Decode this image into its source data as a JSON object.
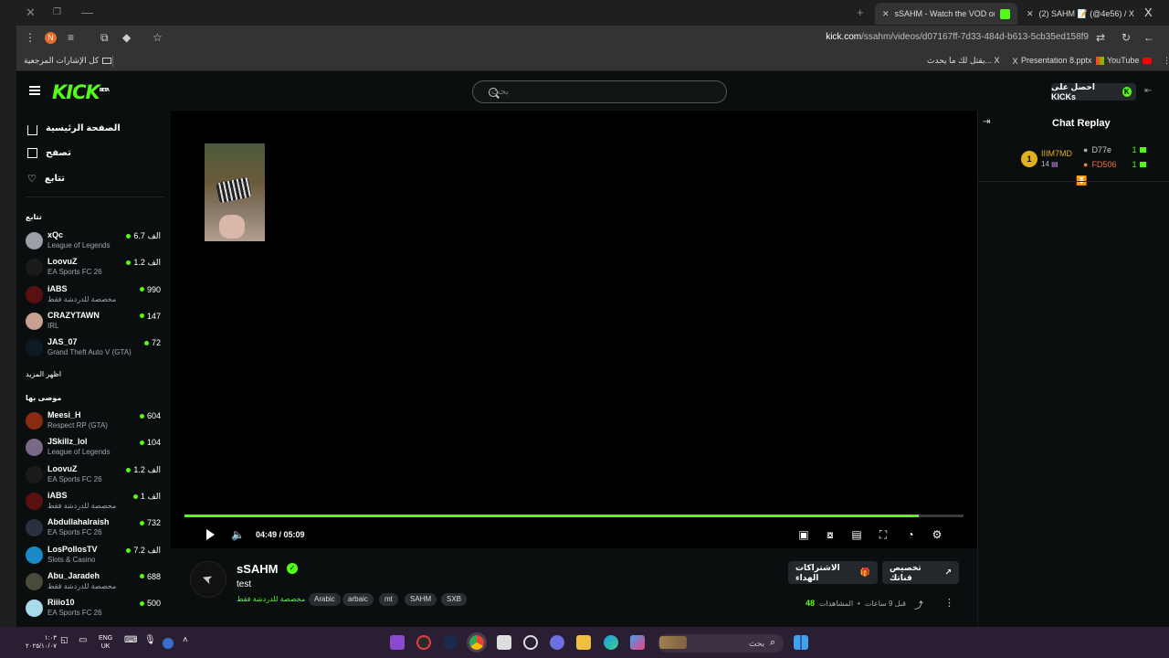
{
  "browser": {
    "tabs": [
      {
        "label": "sSAHM - Watch the VOD on Ki..."
      },
      {
        "label": "(2) SAHM 📝 (@4e56) / X"
      }
    ],
    "url_domain": "kick.com",
    "url_path": "/ssahm/videos/d07167ff-7d33-484d-b613-5cb35ed158f9",
    "bookmarks": {
      "all": "كل الإشارات المرجعية",
      "x_post": "يقتل لك ما يحدث... X",
      "ppt": "Presentation 8.pptx",
      "youtube": "YouTube"
    }
  },
  "header": {
    "logo": "KICK",
    "logo_badge": "BETA",
    "search_placeholder": "بحث",
    "kicks_button": "احصل على KICKs"
  },
  "sidebar": {
    "nav": [
      {
        "label": "الصفحة الرئيسية",
        "icon": "home-icon"
      },
      {
        "label": "تصفح",
        "icon": "browse-icon"
      },
      {
        "label": "تتابع",
        "icon": "heart-icon"
      }
    ],
    "following_title": "تتابع",
    "following": [
      {
        "name": "xQc",
        "category": "League of Legends",
        "viewers": "6.7 الف",
        "avatar": "#9aa0a6"
      },
      {
        "name": "LoovuZ",
        "category": "EA Sports FC 26",
        "viewers": "1.2 الف",
        "avatar": "#1b1b1b"
      },
      {
        "name": "iABS",
        "category": "مخصصة للدردشة فقط",
        "viewers": "990",
        "avatar": "#5a1010"
      },
      {
        "name": "CRAZYTAWN",
        "category": "IRL",
        "viewers": "147",
        "avatar": "#c8a090"
      },
      {
        "name": "JAS_07",
        "category": "Grand Theft Auto V (GTA)",
        "viewers": "72",
        "avatar": "#0c1a24"
      }
    ],
    "show_more": "اظهر المزيد",
    "recommended_title": "موصى بها",
    "recommended": [
      {
        "name": "Meesi_H",
        "category": "Respect RP (GTA)",
        "viewers": "604",
        "avatar": "#8a2a10"
      },
      {
        "name": "JSkillz_lol",
        "category": "League of Legends",
        "viewers": "104",
        "avatar": "#7a6a8a"
      },
      {
        "name": "LoovuZ",
        "category": "EA Sports FC 26",
        "viewers": "1.2 الف",
        "avatar": "#1b1b1b"
      },
      {
        "name": "iABS",
        "category": "مخصصة للدردشة فقط",
        "viewers": "1 الف",
        "avatar": "#5a1010"
      },
      {
        "name": "Abdullahalraish",
        "category": "EA Sports FC 26",
        "viewers": "732",
        "avatar": "#2a3040"
      },
      {
        "name": "LosPollosTV",
        "category": "Slots & Casino",
        "viewers": "7.2 الف",
        "avatar": "#1a8ac8"
      },
      {
        "name": "Abu_Jaradeh",
        "category": "مخصصة للدردشة فقط",
        "viewers": "688",
        "avatar": "#4a4a3a"
      },
      {
        "name": "Riiio10",
        "category": "EA Sports FC 26",
        "viewers": "500",
        "avatar": "#a8dcea"
      }
    ]
  },
  "player": {
    "current_time": "04:49",
    "duration": "05:09",
    "progress_percent": 94.2
  },
  "chat": {
    "title": "Chat Replay",
    "leaderboard_left": {
      "rank": "1",
      "name": "IIIM7MD",
      "count": "14"
    },
    "leaderboard_right": [
      {
        "name": "D77e",
        "count": "1"
      },
      {
        "name": "FD506",
        "count": "1"
      }
    ]
  },
  "video_info": {
    "streamer": "sSAHM",
    "title": "test",
    "category": "مخصصة للدردشة فقط",
    "tags": [
      "Arabic",
      "arbaic",
      "mt",
      "SAHM",
      "SXB"
    ],
    "subscribe_gift": "الاشتراكات الهداء",
    "customize_channel": "تخصيص قناتك",
    "views": "48",
    "views_label": "المشاهدات",
    "time_ago": "قبل 9 ساعات"
  },
  "taskbar": {
    "search": "بحث",
    "lang_top": "ENG",
    "lang_bottom": "UK",
    "clock_time": "١:٠٣",
    "clock_date": "٢٠٢٥/١٠/٠٧"
  },
  "colors": {
    "accent": "#53fc18",
    "background": "#0b0e0f"
  }
}
